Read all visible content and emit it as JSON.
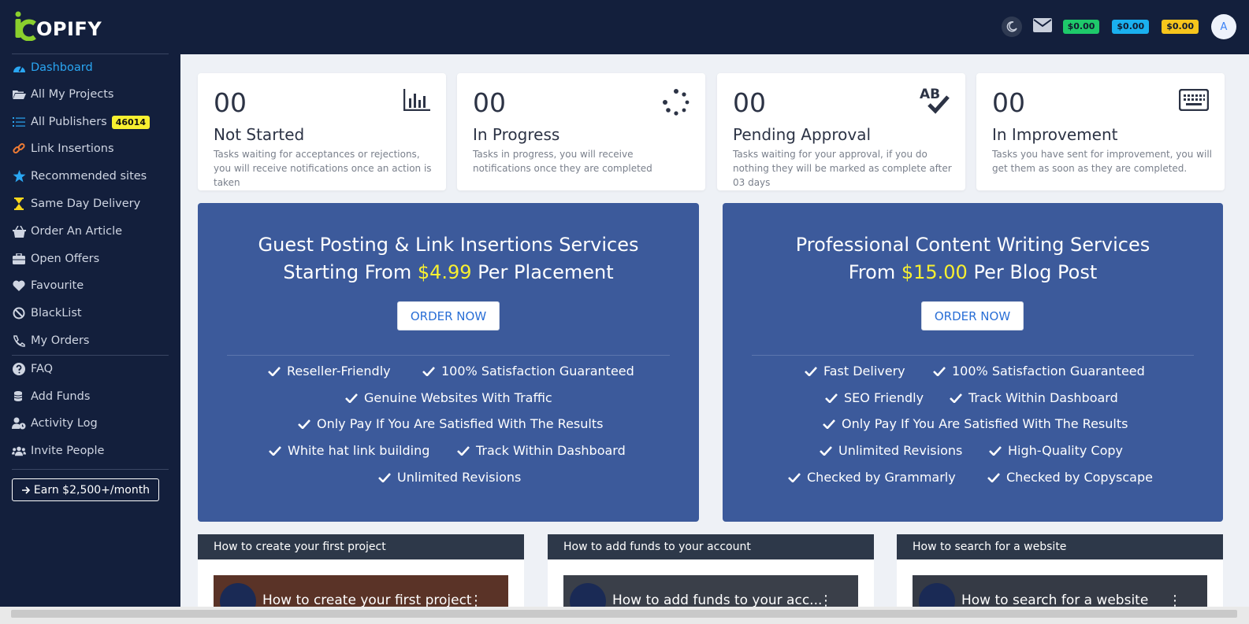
{
  "brand": {
    "name": "OPIFY"
  },
  "header": {
    "balances": [
      "$0.00",
      "$0.00",
      "$0.00"
    ],
    "avatar_initial": "A"
  },
  "sidebar": {
    "items": [
      {
        "label": "Dashboard",
        "icon": "dashboard-icon",
        "badge": ""
      },
      {
        "label": "All My Projects",
        "icon": "folder-open-icon",
        "badge": ""
      },
      {
        "label": "All Publishers",
        "icon": "list-icon",
        "badge": "46014"
      },
      {
        "label": "Link Insertions",
        "icon": "link-icon",
        "badge": ""
      },
      {
        "label": "Recommended sites",
        "icon": "star-icon",
        "badge": ""
      },
      {
        "label": "Same Day Delivery",
        "icon": "hourglass-icon",
        "badge": ""
      },
      {
        "label": "Order An Article",
        "icon": "basket-icon",
        "badge": ""
      },
      {
        "label": "Open Offers",
        "icon": "briefcase-icon",
        "badge": ""
      },
      {
        "label": "Favourite",
        "icon": "heart-icon",
        "badge": ""
      },
      {
        "label": "BlackList",
        "icon": "ban-icon",
        "badge": ""
      },
      {
        "label": "My Orders",
        "icon": "orders-icon",
        "badge": ""
      },
      {
        "label": "FAQ",
        "icon": "question-icon",
        "badge": ""
      },
      {
        "label": "Add Funds",
        "icon": "coins-icon",
        "badge": ""
      },
      {
        "label": "Activity Log",
        "icon": "user-clock-icon",
        "badge": ""
      },
      {
        "label": "Invite People",
        "icon": "users-icon",
        "badge": ""
      }
    ],
    "earn_button": "Earn $2,500+/month"
  },
  "stats": [
    {
      "count": "00",
      "title": "Not Started",
      "desc": "Tasks waiting for acceptances or rejections, you will receive notifications once an action is taken",
      "icon": "bar-chart-icon"
    },
    {
      "count": "00",
      "title": "In Progress",
      "desc": "Tasks in progress, you will receive notifications once they are completed",
      "icon": "spinner-icon"
    },
    {
      "count": "00",
      "title": "Pending Approval",
      "desc": "Tasks waiting for your approval, if you do nothing they will be marked as complete after 03 days",
      "icon": "spell-check-icon"
    },
    {
      "count": "00",
      "title": "In Improvement",
      "desc": "Tasks you have sent for improvement, you will get them as soon as they are completed.",
      "icon": "keyboard-icon"
    }
  ],
  "promos": [
    {
      "title_line1": "Guest Posting & Link Insertions Services",
      "title_prefix": "Starting From ",
      "price": "$4.99",
      "title_suffix": " Per Placement",
      "button": "ORDER NOW",
      "features": [
        [
          "Reseller-Friendly",
          "100% Satisfaction Guaranteed"
        ],
        [
          "Genuine Websites With Traffic"
        ],
        [
          "Only Pay If You Are Satisfied With The Results"
        ],
        [
          "White hat link building",
          "Track Within Dashboard"
        ],
        [
          "Unlimited Revisions"
        ]
      ]
    },
    {
      "title_line1": "Professional Content Writing Services",
      "title_prefix": "From ",
      "price": "$15.00",
      "title_suffix": " Per Blog Post",
      "button": "ORDER NOW",
      "features": [
        [
          "Fast Delivery",
          "100% Satisfaction Guaranteed"
        ],
        [
          "SEO Friendly",
          "Track Within Dashboard"
        ],
        [
          "Only Pay If You Are Satisfied With The Results"
        ],
        [
          "Unlimited Revisions",
          "High-Quality Copy"
        ],
        [
          "Checked by Grammarly",
          "Checked by Copyscape"
        ]
      ]
    }
  ],
  "videos": [
    {
      "heading": "How to create your first project",
      "thumb_title": "How to create your first project"
    },
    {
      "heading": "How to add funds to your account",
      "thumb_title": "How to add funds to your acc..."
    },
    {
      "heading": "How to search for a website",
      "thumb_title": "How to search for a website"
    }
  ],
  "colors": {
    "sidebar_bg": "#131f3c",
    "content_bg": "#eef1f6",
    "promo_bg": "#3c5a9b",
    "accent_active": "#2aa6f2",
    "price_highlight": "#f8f030"
  }
}
